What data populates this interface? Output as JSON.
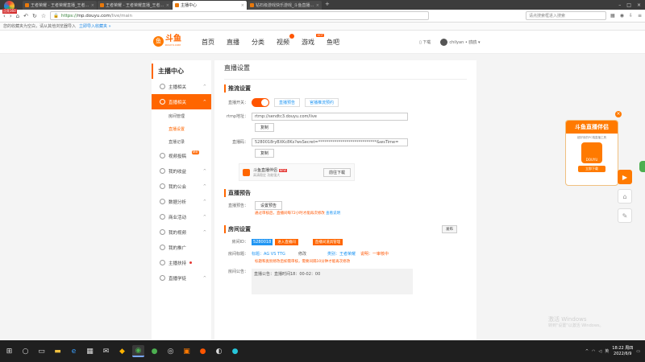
{
  "browser": {
    "logo_label": "点亮360",
    "tabs": [
      {
        "title": "王者荣耀 - 王者荣耀直播_王者...",
        "active": false
      },
      {
        "title": "王者荣耀 - 王者荣耀直播_王者...",
        "active": false
      },
      {
        "title": "主播中心",
        "active": true
      },
      {
        "title": "钻石级游戏快乐游戏_斗鱼直播...",
        "active": false
      }
    ],
    "new_tab": "+",
    "url": "https://mp.douyu.com/live/main",
    "url_scheme": "https://",
    "url_host": "mp.douyu.com",
    "url_path": "/live/main",
    "web_search_placeholder": "请点搜索框进入搜索",
    "bookmark_notice": "您的收藏夹为空白，请从其他浏览器导入",
    "bookmark_link": "立即导入收藏夹 »"
  },
  "site": {
    "logo_text": "斗鱼",
    "logo_sub": "DOUYU.COM",
    "nav": [
      "首页",
      "直播",
      "分类",
      "视频",
      "游戏",
      "鱼吧"
    ],
    "nav_game_badge": "HOT",
    "download": "下载",
    "user": "chilyan • 鸥鸥"
  },
  "sidebar": {
    "title": "主播中心",
    "items": [
      {
        "label": "主播相关",
        "chev": "^"
      },
      {
        "label": "直播相关",
        "chev": "^",
        "active": true
      },
      {
        "label": "房间管理",
        "sub": true
      },
      {
        "label": "直播设置",
        "sub": true,
        "on": true
      },
      {
        "label": "直播记录",
        "sub": true
      },
      {
        "label": "视频投稿",
        "chev": "",
        "hot": "精彩"
      },
      {
        "label": "我的收益",
        "chev": "^"
      },
      {
        "label": "我的公会",
        "chev": "^"
      },
      {
        "label": "数据分析",
        "chev": "^"
      },
      {
        "label": "商业活动",
        "chev": "^"
      },
      {
        "label": "我的视频",
        "chev": "^"
      },
      {
        "label": "我的推广",
        "chev": ""
      },
      {
        "label": "主播扶持",
        "chev": "",
        "dot": true
      },
      {
        "label": "直播学徒",
        "chev": "^"
      }
    ]
  },
  "content": {
    "page_title": "直播设置",
    "push": {
      "section": "推流设置",
      "switch_label": "直播开关：",
      "switch_btn1": "直播预告",
      "switch_btn2": "官播推流预约",
      "rtmp_label": "rtmp地址：",
      "rtmp_value": "rtmp://sendtc3.douyu.com/live",
      "copy1": "复制",
      "code_label": "直播码：",
      "code_value": "5280018ryBXKc8Ks?wsSecret=*****************************&wsTime=",
      "copy2": "复制",
      "promo_title": "斗鱼直播伴侣",
      "promo_new": "NEW",
      "promo_sub": "高清稳定 功能强大",
      "promo_download": "前往下载"
    },
    "preview": {
      "section": "直播预告",
      "label": "直播预告：",
      "btn": "设置预告",
      "warn": "通过审核后，直播间每72小时才能再次修改",
      "warn_link": "查看说明"
    },
    "room": {
      "section": "房间设置",
      "publish_btn": "发布",
      "id_label": "房间ID：",
      "id_value": "5280018",
      "id_btn1": "进入直播间",
      "id_btn2": "直播间道具管理",
      "title_label": "房间标题：",
      "title_value": "标题：AG VS TTG",
      "title_btn": "修改",
      "category": "类别：王者荣耀",
      "category_tip": "说明：一审核中",
      "title_warn": "标题和类别修改后如需审核，需要间隔10分钟才能再次修改",
      "notice_label": "房间公告：",
      "notice_value": "直播公告：直播时间18：00-02：00"
    }
  },
  "float": {
    "card_title": "斗鱼直播伴侣",
    "card_desc": "超好用的PC端直播工具",
    "card_icon_text": "DOUYU",
    "card_btn": "立即下载",
    "close": "×"
  },
  "activation": {
    "line1": "激活 Windows",
    "line2": "转到\"设置\"以激活 Windows。"
  },
  "taskbar": {
    "time": "18:22 周四",
    "date": "2022/6/9"
  }
}
